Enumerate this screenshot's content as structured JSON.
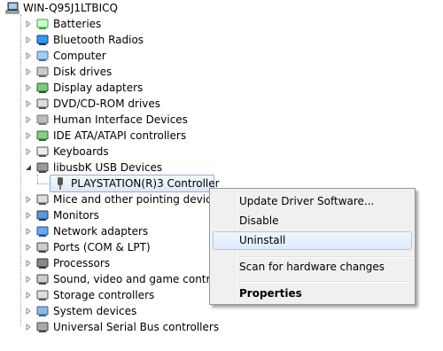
{
  "tree": {
    "root_label": "WIN-Q95J1LTBICQ",
    "categories": [
      {
        "label": "Batteries",
        "icon": "battery-icon"
      },
      {
        "label": "Bluetooth Radios",
        "icon": "bluetooth-icon"
      },
      {
        "label": "Computer",
        "icon": "computer-icon"
      },
      {
        "label": "Disk drives",
        "icon": "disk-drive-icon"
      },
      {
        "label": "Display adapters",
        "icon": "display-adapter-icon"
      },
      {
        "label": "DVD/CD-ROM drives",
        "icon": "dvd-drive-icon"
      },
      {
        "label": "Human Interface Devices",
        "icon": "hid-icon"
      },
      {
        "label": "IDE ATA/ATAPI controllers",
        "icon": "ide-controller-icon"
      },
      {
        "label": "Keyboards",
        "icon": "keyboard-icon"
      },
      {
        "label": "libusbK USB Devices",
        "icon": "usb-device-icon"
      },
      {
        "label": "Mice and other pointing devices",
        "icon": "mouse-icon"
      },
      {
        "label": "Monitors",
        "icon": "monitor-icon"
      },
      {
        "label": "Network adapters",
        "icon": "network-adapter-icon"
      },
      {
        "label": "Ports (COM & LPT)",
        "icon": "port-icon"
      },
      {
        "label": "Processors",
        "icon": "processor-icon"
      },
      {
        "label": "Sound, video and game controllers",
        "icon": "sound-icon"
      },
      {
        "label": "Storage controllers",
        "icon": "storage-controller-icon"
      },
      {
        "label": "System devices",
        "icon": "system-device-icon"
      },
      {
        "label": "Universal Serial Bus controllers",
        "icon": "usb-controller-icon"
      }
    ],
    "selected_child": {
      "label": "PLAYSTATION(R)3 Controller",
      "icon": "usb-plug-icon"
    }
  },
  "context_menu": {
    "items": [
      {
        "label": "Update Driver Software..."
      },
      {
        "label": "Disable"
      },
      {
        "label": "Uninstall",
        "highlighted": true
      },
      {
        "label": "Scan for hardware changes"
      },
      {
        "label": "Properties",
        "bold": true
      }
    ]
  }
}
